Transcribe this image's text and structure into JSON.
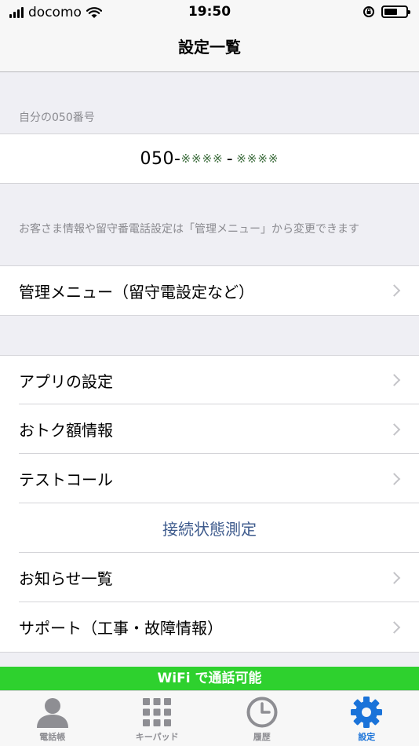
{
  "status": {
    "carrier": "docomo",
    "time": "19:50"
  },
  "nav": {
    "title": "設定一覧"
  },
  "number_section": {
    "label": "自分の050番号",
    "prefix": "050-",
    "part1": "※※※※",
    "dash": "-",
    "part2": "※※※※"
  },
  "admin_section": {
    "note": "お客さま情報や留守番電話設定は「管理メニュー」から変更できます",
    "item": "管理メニュー（留守電設定など）"
  },
  "settings_list": {
    "app_settings": "アプリの設定",
    "discount_info": "おトク額情報",
    "test_call": "テストコール",
    "connection_test": "接続状態測定",
    "notices": "お知らせ一覧",
    "support": "サポート（工事・故障情報）"
  },
  "banner": {
    "text": "WiFi で通話可能"
  },
  "tabs": [
    {
      "label": "電話帳",
      "icon": "contacts-icon"
    },
    {
      "label": "キーパッド",
      "icon": "keypad-icon"
    },
    {
      "label": "履歴",
      "icon": "clock-icon"
    },
    {
      "label": "設定",
      "icon": "gear-icon",
      "active": true
    }
  ],
  "colors": {
    "accent": "#1a73d9",
    "banner": "#2ed12e",
    "link": "#3d5a8c"
  }
}
